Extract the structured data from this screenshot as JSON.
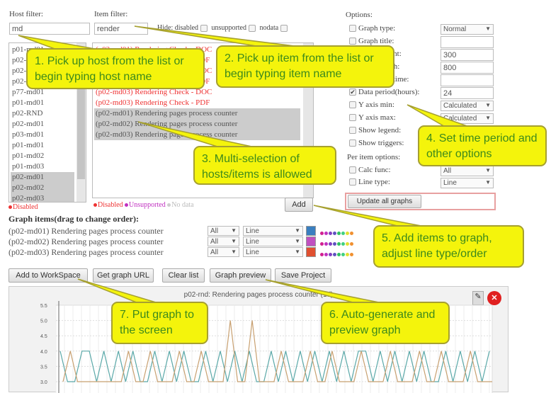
{
  "host_filter": {
    "label": "Host filter:",
    "value": "md"
  },
  "item_filter": {
    "label": "Item filter:",
    "value": "render"
  },
  "hide": {
    "label": "Hide: disabled",
    "unsupported": "unsupported",
    "nodata": "nodata"
  },
  "hosts": [
    "p01-md01",
    "p02-md01",
    "p02-md02",
    "p02-md03",
    "p77-md01",
    "p01-md01",
    "p02-RND",
    "p02-md01",
    "p03-md01",
    "p01-md01",
    "p01-md02",
    "p01-md03",
    "p02-md01",
    "p02-md02",
    "p02-md03"
  ],
  "hosts_selected": [
    12,
    13,
    14
  ],
  "host_legend": "Disabled",
  "items": [
    {
      "text": "(p02-md01) Rendering Check - DOC",
      "state": "disabled"
    },
    {
      "text": "(p02-md01) Rendering Check - PDF",
      "state": "disabled"
    },
    {
      "text": "(p02-md02) Rendering Check - DOC",
      "state": "disabled"
    },
    {
      "text": "(p02-md02) Rendering Check - PDF",
      "state": "disabled"
    },
    {
      "text": "(p02-md03) Rendering Check - DOC",
      "state": "disabled"
    },
    {
      "text": "(p02-md03) Rendering Check - PDF",
      "state": "disabled"
    },
    {
      "text": "(p02-md01) Rendering pages process counter",
      "state": "selected"
    },
    {
      "text": "(p02-md02) Rendering pages process counter",
      "state": "selected"
    },
    {
      "text": "(p02-md03) Rendering pages process counter",
      "state": "selected"
    }
  ],
  "item_legend": {
    "disabled": "Disabled",
    "unsupported": "Unsupported",
    "nodata": "No data"
  },
  "add_label": "Add",
  "options": {
    "title": "Options:",
    "rows": [
      {
        "label": "Graph type:",
        "checked": false,
        "control": "select",
        "value": "Normal"
      },
      {
        "label": "Graph title:",
        "checked": false,
        "control": "input",
        "value": ""
      },
      {
        "label": "Graph height:",
        "checked": false,
        "control": "input",
        "value": "300"
      },
      {
        "label": "Graph width:",
        "checked": false,
        "control": "input",
        "value": "800"
      },
      {
        "label": "Graph end time:",
        "checked": false,
        "control": "input",
        "value": ""
      },
      {
        "label": "Data period(hours):",
        "checked": true,
        "control": "input",
        "value": "24"
      },
      {
        "label": "Y axis min:",
        "checked": false,
        "control": "select",
        "value": "Calculated"
      },
      {
        "label": "Y axis max:",
        "checked": false,
        "control": "select",
        "value": "Calculated"
      },
      {
        "label": "Show legend:",
        "checked": false,
        "control": "none",
        "value": ""
      },
      {
        "label": "Show triggers:",
        "checked": false,
        "control": "none",
        "value": ""
      }
    ],
    "per_item_title": "Per item options:",
    "per_item": [
      {
        "label": "Calc func:",
        "value": "All"
      },
      {
        "label": "Line type:",
        "value": "Line"
      }
    ],
    "update_all": "Update all graphs"
  },
  "graph_items": {
    "title": "Graph items(drag to change order):",
    "rows": [
      {
        "name": "(p02-md01) Rendering pages process counter",
        "func": "All",
        "type": "Line",
        "color": "#3a7fc0"
      },
      {
        "name": "(p02-md02) Rendering pages process counter",
        "func": "All",
        "type": "Line",
        "color": "#c050c0"
      },
      {
        "name": "(p02-md03) Rendering pages process counter",
        "func": "All",
        "type": "Line",
        "color": "#e05030"
      }
    ],
    "palette": [
      "#d02090",
      "#c030c0",
      "#8040c0",
      "#6050c0",
      "#30c060",
      "#40d080",
      "#e0e030",
      "#f09030"
    ]
  },
  "buttons": {
    "workspace": "Add to WorkSpace",
    "url": "Get graph URL",
    "clear": "Clear list",
    "preview": "Graph preview",
    "save": "Save Project"
  },
  "callouts": {
    "c1": "1. Pick up host from the list or begin typing host name",
    "c2": "2. Pick up item from the list or begin typing item name",
    "c3": "3. Multi-selection of hosts/items is allowed",
    "c4": "4. Set time period and other options",
    "c5": "5. Add items to graph, adjust line type/order",
    "c6": "6. Auto-generate and preview graph",
    "c7": "7. Put graph to the screen"
  },
  "colors": {
    "callout": "#f4f40c",
    "callout_text": "#3d8a1c",
    "disabled": "#e33333",
    "unsupported": "#c030c0",
    "series_teal": "#5aa8a8",
    "series_tan": "#c8a070"
  },
  "chart_data": {
    "type": "line",
    "title": "p02-rnd: Rendering pages process counter (1d)",
    "yticks": [
      "5.5",
      "5.0",
      "4.5",
      "4.0",
      "3.5",
      "3.0"
    ],
    "ylim": [
      3.0,
      5.5
    ],
    "grid": true,
    "series": [
      {
        "color": "#5aa8a8",
        "values": [
          4,
          3,
          3,
          4,
          4,
          3,
          4,
          3,
          4,
          3,
          4,
          3,
          3,
          4,
          3,
          4,
          3,
          4,
          3,
          3,
          4,
          3,
          4,
          3,
          4,
          3,
          4,
          3,
          3,
          4,
          3,
          4,
          3,
          4,
          3,
          4,
          3,
          4,
          3,
          4,
          3,
          4,
          4,
          3,
          4,
          3,
          4,
          3,
          4,
          3,
          4,
          3,
          3,
          4,
          3,
          4,
          3,
          4,
          3,
          4
        ]
      },
      {
        "color": "#c8a070",
        "values": [
          3,
          4,
          3,
          3,
          3,
          3,
          3,
          3,
          3,
          4,
          3,
          3,
          4,
          3,
          3,
          3,
          4,
          3,
          3,
          4,
          3,
          3,
          3,
          5,
          3,
          3,
          5,
          3,
          3,
          3,
          4,
          3,
          3,
          3,
          4,
          3,
          3,
          4,
          3,
          3,
          3,
          4,
          3,
          3,
          3,
          4,
          3,
          3,
          3,
          4,
          3,
          3,
          4,
          3,
          3,
          3,
          4,
          3,
          3,
          3
        ]
      }
    ]
  }
}
